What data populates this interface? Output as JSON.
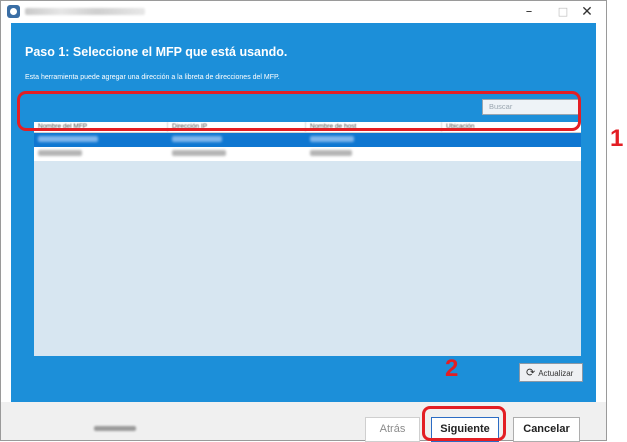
{
  "window": {
    "title": "",
    "controls": {
      "minimize": "–",
      "maximize": "□",
      "close": "✕"
    }
  },
  "page": {
    "heading": "Paso 1: Seleccione el MFP que está usando.",
    "description": "Esta herramienta puede agregar una dirección a la libreta de direcciones del MFP."
  },
  "search": {
    "placeholder": "Buscar"
  },
  "table": {
    "columns": [
      "Nombre del MFP",
      "Dirección IP",
      "Nombre de host",
      "Ubicación"
    ],
    "rows": [
      {
        "selected": true,
        "cells": [
          "",
          "",
          "",
          ""
        ]
      },
      {
        "selected": false,
        "cells": [
          "",
          "",
          "",
          ""
        ]
      }
    ]
  },
  "refresh": {
    "icon": "refresh-icon",
    "label": "Actualizar"
  },
  "annotations": {
    "marker1": "1",
    "marker2": "2",
    "color": "#e31e24"
  },
  "footer": {
    "back_label": "Atrás",
    "next_label": "Siguiente",
    "cancel_label": "Cancelar"
  },
  "colors": {
    "content_bg": "#1c8fd9",
    "selected_row": "#0f77d1"
  }
}
